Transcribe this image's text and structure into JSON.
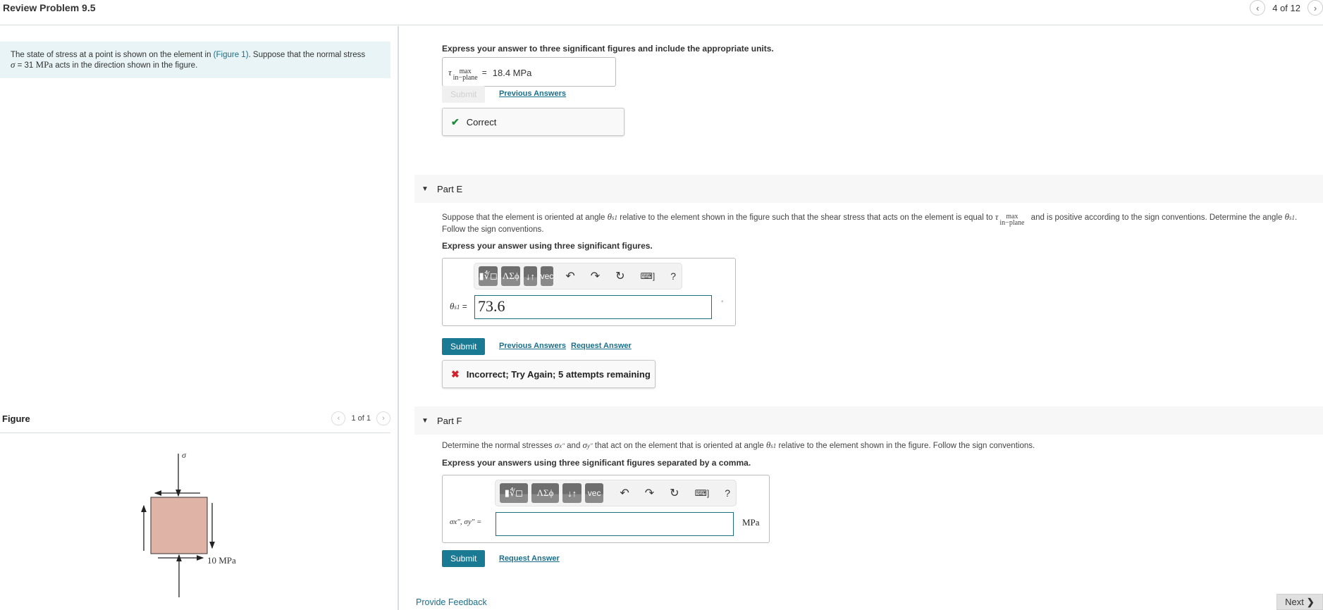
{
  "header": {
    "title": "Review Problem 9.5",
    "pager": {
      "prev_icon": "chevron-left-icon",
      "count": "4 of 12",
      "next_icon": "chevron-right-icon"
    }
  },
  "intro": {
    "text_before": "The state of stress at a point is shown on the element in ",
    "figure_link": "(Figure 1)",
    "text_after": ". Suppose that the normal stress",
    "line2_sigma": "σ",
    "line2_eq": " = 31 ",
    "line2_unit": "MPa",
    "line2_rest": " acts in the direction shown in the figure."
  },
  "figure_panel": {
    "label": "Figure",
    "count": "1 of 1",
    "diagram": {
      "sigma_label": "σ",
      "shear_label": "10 MPa",
      "fill_color": "#dfb3a6"
    }
  },
  "part_d": {
    "instruction": "Express your answer to three significant figures and include the appropriate units.",
    "var_symbol": "τ",
    "var_sub_top": "max",
    "var_sub_bottom": "in−plane",
    "equals": "=",
    "answer": "18.4 MPa",
    "submit_label": "Submit",
    "previous_answers": "Previous Answers",
    "feedback": {
      "status": "Correct",
      "icon": "check-icon",
      "color": "#1e8a3c"
    }
  },
  "part_e": {
    "title": "Part E",
    "text1_a": "Suppose that the element is oriented at angle ",
    "theta": "θ",
    "theta_sub": "s1",
    "text1_b": " relative to the element shown in the figure such that the shear stress that acts on the element is equal to ",
    "tau": "τ",
    "tau_sub_top": "max",
    "tau_sub_bottom": "in−plane",
    "text1_c": " and is positive according to the sign conventions. Determine the angle ",
    "text1_d": ".",
    "text2": "Follow the sign conventions.",
    "instruction": "Express your answer using three significant figures.",
    "toolbar": {
      "templates": "▮∜◻",
      "greek": "ΛΣϕ",
      "arrows": "↓↑",
      "vec": "vec",
      "undo_icon": "undo-icon",
      "redo_icon": "redo-icon",
      "reset_icon": "reset-icon",
      "keyboard_icon": "keyboard-icon",
      "help": "?"
    },
    "input_label": "θ",
    "input_label_sub": "s1",
    "input_equals": "=",
    "input_value": "73.6",
    "unit": "°",
    "submit_label": "Submit",
    "previous_answers": "Previous Answers",
    "request_answer": "Request Answer",
    "feedback": {
      "status": "Incorrect; Try Again; 5 attempts remaining",
      "icon": "x-icon",
      "color": "#d0232c"
    }
  },
  "part_f": {
    "title": "Part F",
    "text1_a": "Determine the normal stresses ",
    "sx": "σ",
    "sx_sub": "x″",
    "and": " and ",
    "sy": "σ",
    "sy_sub": "y″",
    "text1_b": " that act on the element that is oriented at angle ",
    "theta": "θ",
    "theta_sub": "s1",
    "text1_c": " relative to the element shown in the figure. Follow the sign conventions.",
    "instruction": "Express your answers using three significant figures separated by a comma.",
    "toolbar": {
      "templates": "▮∜◻",
      "greek": "ΛΣϕ",
      "arrows": "↓↑",
      "vec": "vec",
      "help": "?"
    },
    "input_label": "σx″, σy″ =",
    "input_value": "",
    "unit": "MPa",
    "submit_label": "Submit",
    "request_answer": "Request Answer"
  },
  "footer": {
    "feedback_link": "Provide Feedback",
    "next_label": "Next",
    "next_icon": "chevron-right-icon"
  }
}
